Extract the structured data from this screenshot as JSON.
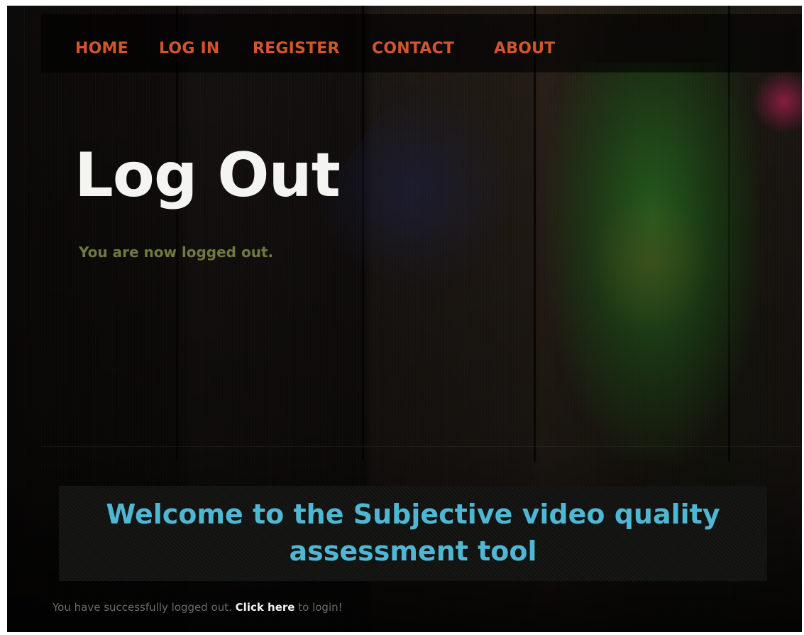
{
  "nav": {
    "items": [
      {
        "label": "HOME"
      },
      {
        "label": "LOG IN"
      },
      {
        "label": "REGISTER"
      },
      {
        "label": "CONTACT"
      },
      {
        "label": "ABOUT"
      }
    ],
    "color": "#d2552c"
  },
  "main": {
    "title": "Log Out",
    "subtitle": "You are now logged out."
  },
  "welcome": {
    "text": "Welcome to the Subjective video quality assessment tool",
    "color": "#4fb7d3"
  },
  "footer": {
    "prefix": "You have successfully logged out.",
    "link_label": "Click here",
    "suffix": "to login!"
  }
}
